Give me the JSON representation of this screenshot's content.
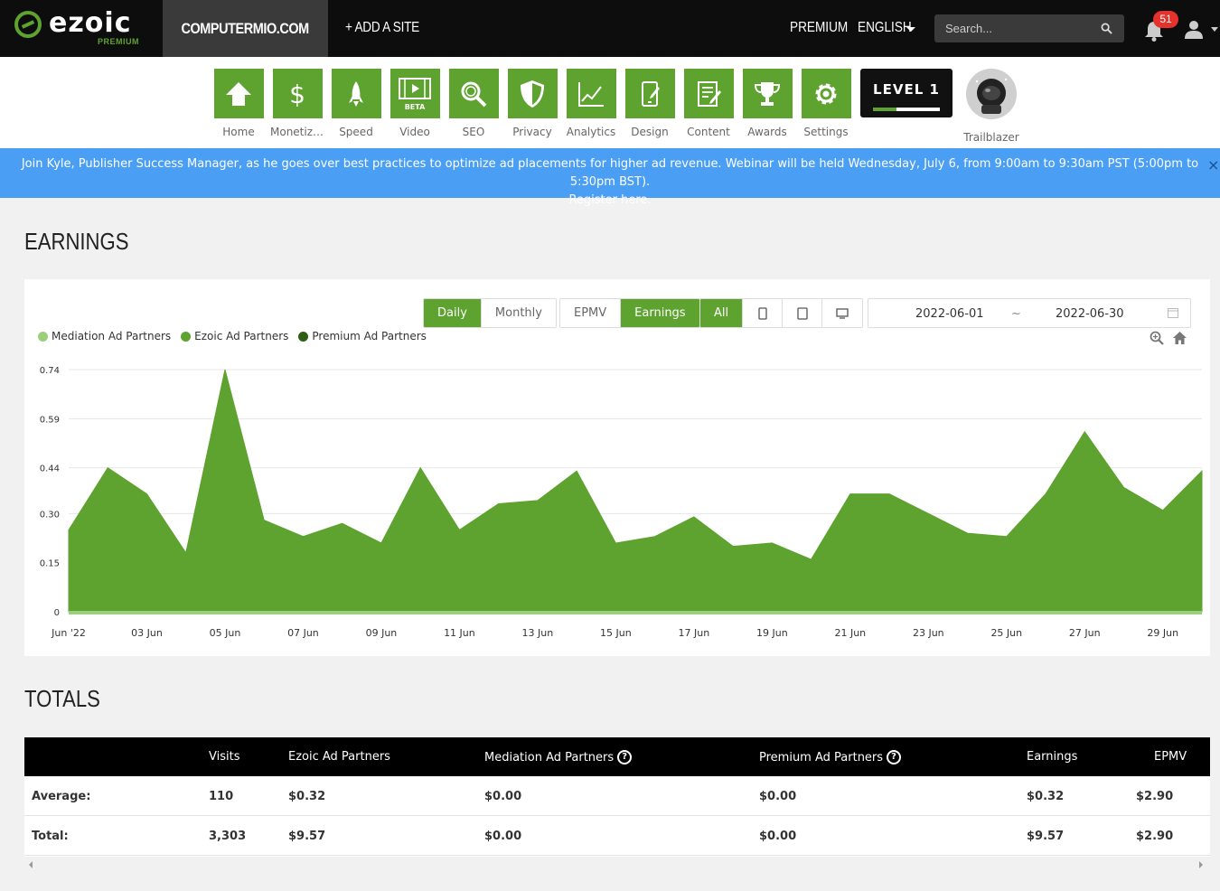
{
  "topbar": {
    "logo_text": "ezoic",
    "logo_sub": "PREMIUM",
    "site_name": "COMPUTERMIO.COM",
    "add_site": "+ ADD A SITE",
    "premium": "PREMIUM",
    "language": "ENGLISH",
    "search_placeholder": "Search...",
    "notification_count": "51",
    "accent_color": "#5ea22f"
  },
  "nav": {
    "items": [
      {
        "label": "Home",
        "icon": "home-icon"
      },
      {
        "label": "Monetiza...",
        "icon": "dollar-icon"
      },
      {
        "label": "Speed",
        "icon": "rocket-icon"
      },
      {
        "label": "Video",
        "icon": "video-icon",
        "badge": "BETA"
      },
      {
        "label": "SEO",
        "icon": "magnifier-icon"
      },
      {
        "label": "Privacy",
        "icon": "shield-icon"
      },
      {
        "label": "Analytics",
        "icon": "line-chart-icon"
      },
      {
        "label": "Design",
        "icon": "device-edit-icon"
      },
      {
        "label": "Content",
        "icon": "document-edit-icon"
      },
      {
        "label": "Awards",
        "icon": "trophy-icon"
      },
      {
        "label": "Settings",
        "icon": "gear-icon"
      }
    ],
    "level_label": "LEVEL 1",
    "level_progress": 0.35,
    "trailblazer_label": "Trailblazer"
  },
  "banner": {
    "text": "Join Kyle, Publisher Success Manager, as he goes over best practices to optimize ad placements for higher ad revenue. Webinar will be held Wednesday, July 6, from 9:00am to 9:30am PST (5:00pm to 5:30pm BST).",
    "link_text": "Register here.",
    "close": "×"
  },
  "earnings": {
    "title": "EARNINGS",
    "period_buttons": [
      "Daily",
      "Monthly"
    ],
    "metric_buttons": [
      "EPMV",
      "Earnings"
    ],
    "device_all": "All",
    "date_start": "2022-06-01",
    "date_sep": "~",
    "date_end": "2022-06-30"
  },
  "chart_data": {
    "type": "area",
    "title": "",
    "xlabel": "",
    "ylabel": "",
    "ylim": [
      0,
      0.74
    ],
    "y_ticks": [
      "0",
      "0.15",
      "0.30",
      "0.44",
      "0.59",
      "0.74"
    ],
    "x_ticks": [
      "Jun '22",
      "03 Jun",
      "05 Jun",
      "07 Jun",
      "09 Jun",
      "11 Jun",
      "13 Jun",
      "15 Jun",
      "17 Jun",
      "19 Jun",
      "21 Jun",
      "23 Jun",
      "25 Jun",
      "27 Jun",
      "29 Jun"
    ],
    "grid": true,
    "legend_position": "top-left",
    "series": [
      {
        "name": "Mediation Ad Partners",
        "color": "#9ccf7c",
        "values": [
          0,
          0,
          0,
          0,
          0,
          0,
          0,
          0,
          0,
          0,
          0,
          0,
          0,
          0,
          0,
          0,
          0,
          0,
          0,
          0,
          0,
          0,
          0,
          0,
          0,
          0,
          0,
          0,
          0,
          0
        ]
      },
      {
        "name": "Ezoic Ad Partners",
        "color": "#5ea22f",
        "values": [
          0.25,
          0.44,
          0.36,
          0.18,
          0.74,
          0.28,
          0.23,
          0.27,
          0.21,
          0.44,
          0.25,
          0.33,
          0.34,
          0.43,
          0.21,
          0.23,
          0.29,
          0.2,
          0.21,
          0.16,
          0.36,
          0.36,
          0.3,
          0.24,
          0.23,
          0.36,
          0.55,
          0.38,
          0.31,
          0.43
        ]
      },
      {
        "name": "Premium Ad Partners",
        "color": "#2e5e14",
        "values": [
          0,
          0,
          0,
          0,
          0,
          0,
          0,
          0,
          0,
          0,
          0,
          0,
          0,
          0,
          0,
          0,
          0,
          0,
          0,
          0,
          0,
          0,
          0,
          0,
          0,
          0,
          0,
          0,
          0,
          0
        ]
      }
    ]
  },
  "totals": {
    "title": "TOTALS",
    "columns": [
      "Visits",
      "Ezoic Ad Partners",
      "Mediation Ad Partners",
      "Premium Ad Partners",
      "Earnings",
      "EPMV"
    ],
    "rows": [
      {
        "label": "Average:",
        "values": [
          "110",
          "$0.32",
          "$0.00",
          "$0.00",
          "$0.32",
          "$2.90"
        ]
      },
      {
        "label": "Total:",
        "values": [
          "3,303",
          "$9.57",
          "$0.00",
          "$0.00",
          "$9.57",
          "$2.90"
        ]
      }
    ]
  }
}
